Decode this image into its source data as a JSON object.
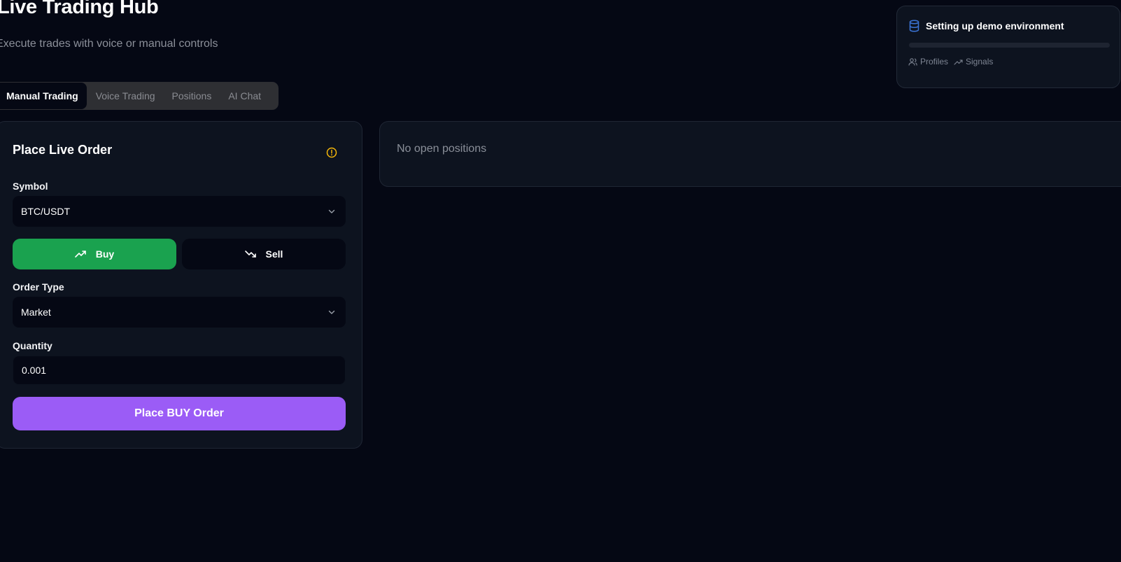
{
  "header": {
    "title": "Live Trading Hub",
    "subtitle": "Execute trades with voice or manual controls"
  },
  "tabs": [
    {
      "label": "Manual Trading",
      "active": true
    },
    {
      "label": "Voice Trading",
      "active": false
    },
    {
      "label": "Positions",
      "active": false
    },
    {
      "label": "AI Chat",
      "active": false
    }
  ],
  "order_form": {
    "title": "Place Live Order",
    "warning_icon": "alert-circle-icon",
    "symbol_label": "Symbol",
    "symbol_value": "BTC/USDT",
    "buy_label": "Buy",
    "sell_label": "Sell",
    "selected_side": "buy",
    "order_type_label": "Order Type",
    "order_type_value": "Market",
    "quantity_label": "Quantity",
    "quantity_value": "0.001",
    "submit_label": "Place BUY Order"
  },
  "positions": {
    "empty_text": "No open positions"
  },
  "toast": {
    "icon": "database-icon",
    "title": "Setting up demo environment",
    "progress": 0,
    "links": [
      {
        "label": "Profiles",
        "icon": "users-icon"
      },
      {
        "label": "Signals",
        "icon": "trending-up-icon"
      }
    ]
  },
  "colors": {
    "background": "#050814",
    "card": "#0d131f",
    "buy": "#1aa24f",
    "primary": "#9b5cf6",
    "warning": "#f5b70a",
    "info": "#3b74d6"
  }
}
